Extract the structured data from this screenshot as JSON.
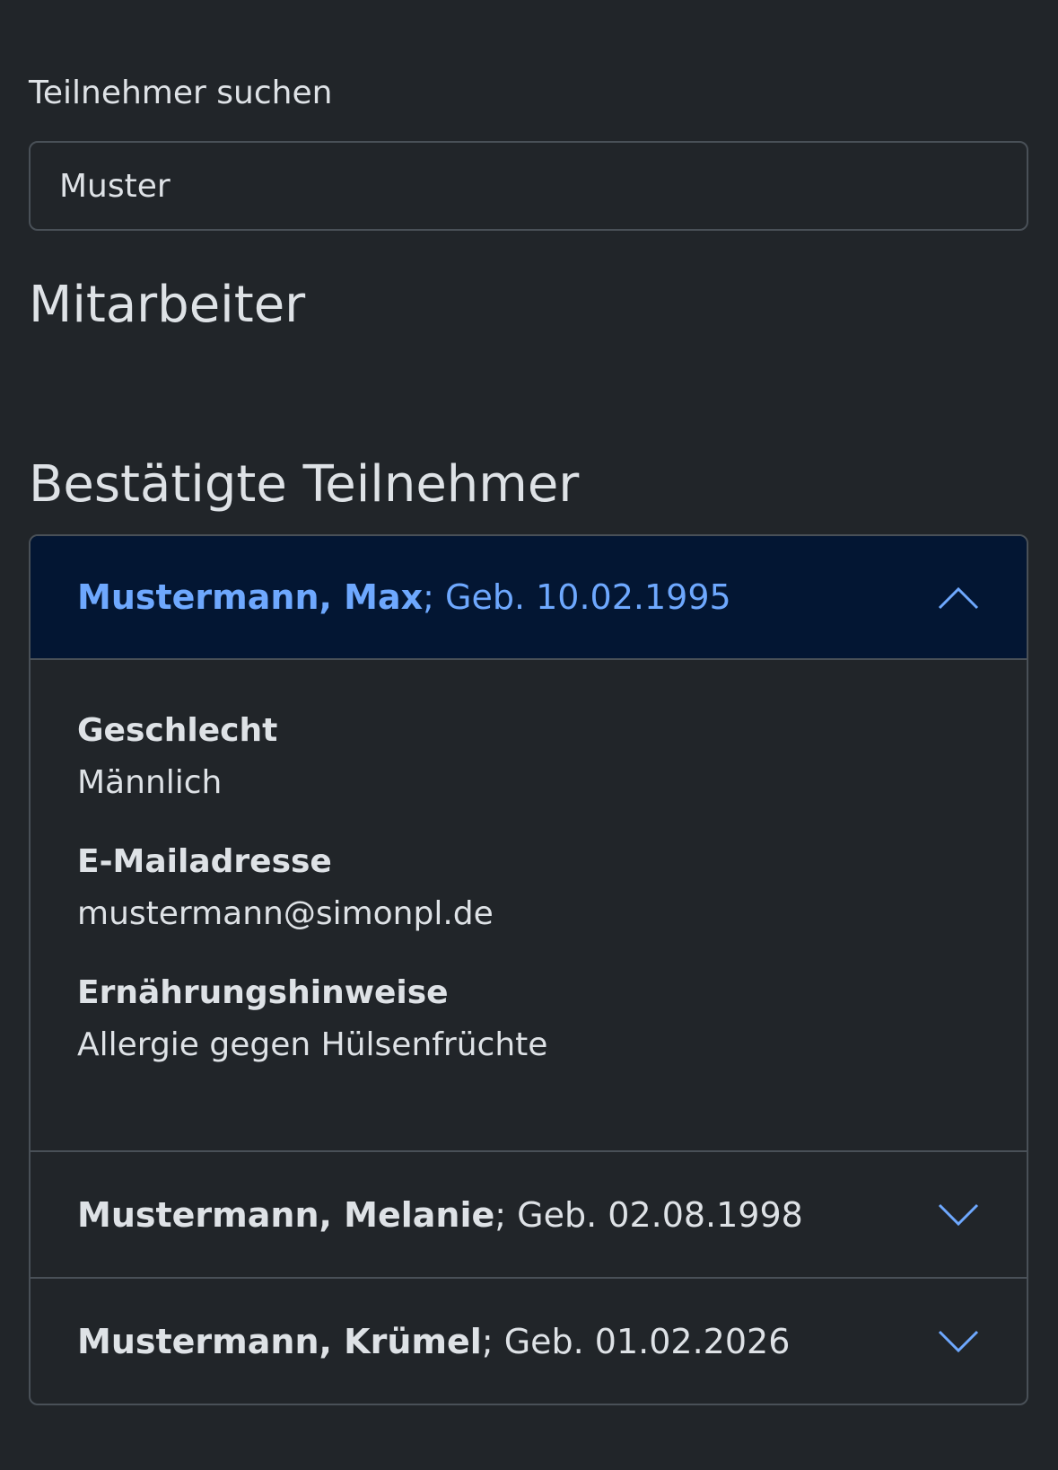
{
  "search": {
    "label": "Teilnehmer suchen",
    "value": "Muster"
  },
  "sections": {
    "staff_heading": "Mitarbeiter",
    "confirmed_heading": "Bestätigte Teilnehmer"
  },
  "participants": [
    {
      "name": "Mustermann, Max",
      "birth": "; Geb. 10.02.1995",
      "expanded": true,
      "details": {
        "gender_label": "Geschlecht",
        "gender_value": "Männlich",
        "email_label": "E-Mailadresse",
        "email_value": "mustermann@simonpl.de",
        "diet_label": "Ernährungshinweise",
        "diet_value": "Allergie gegen Hülsenfrüchte"
      }
    },
    {
      "name": "Mustermann, Melanie",
      "birth": "; Geb. 02.08.1998",
      "expanded": false
    },
    {
      "name": "Mustermann, Krümel",
      "birth": "; Geb. 01.02.2026",
      "expanded": false
    }
  ],
  "colors": {
    "background": "#212529",
    "accent": "#6ea8fe",
    "open_header_bg": "#031633",
    "border": "#495057"
  },
  "icons": {
    "expanded": "chevron-up-icon",
    "collapsed": "chevron-down-icon"
  }
}
